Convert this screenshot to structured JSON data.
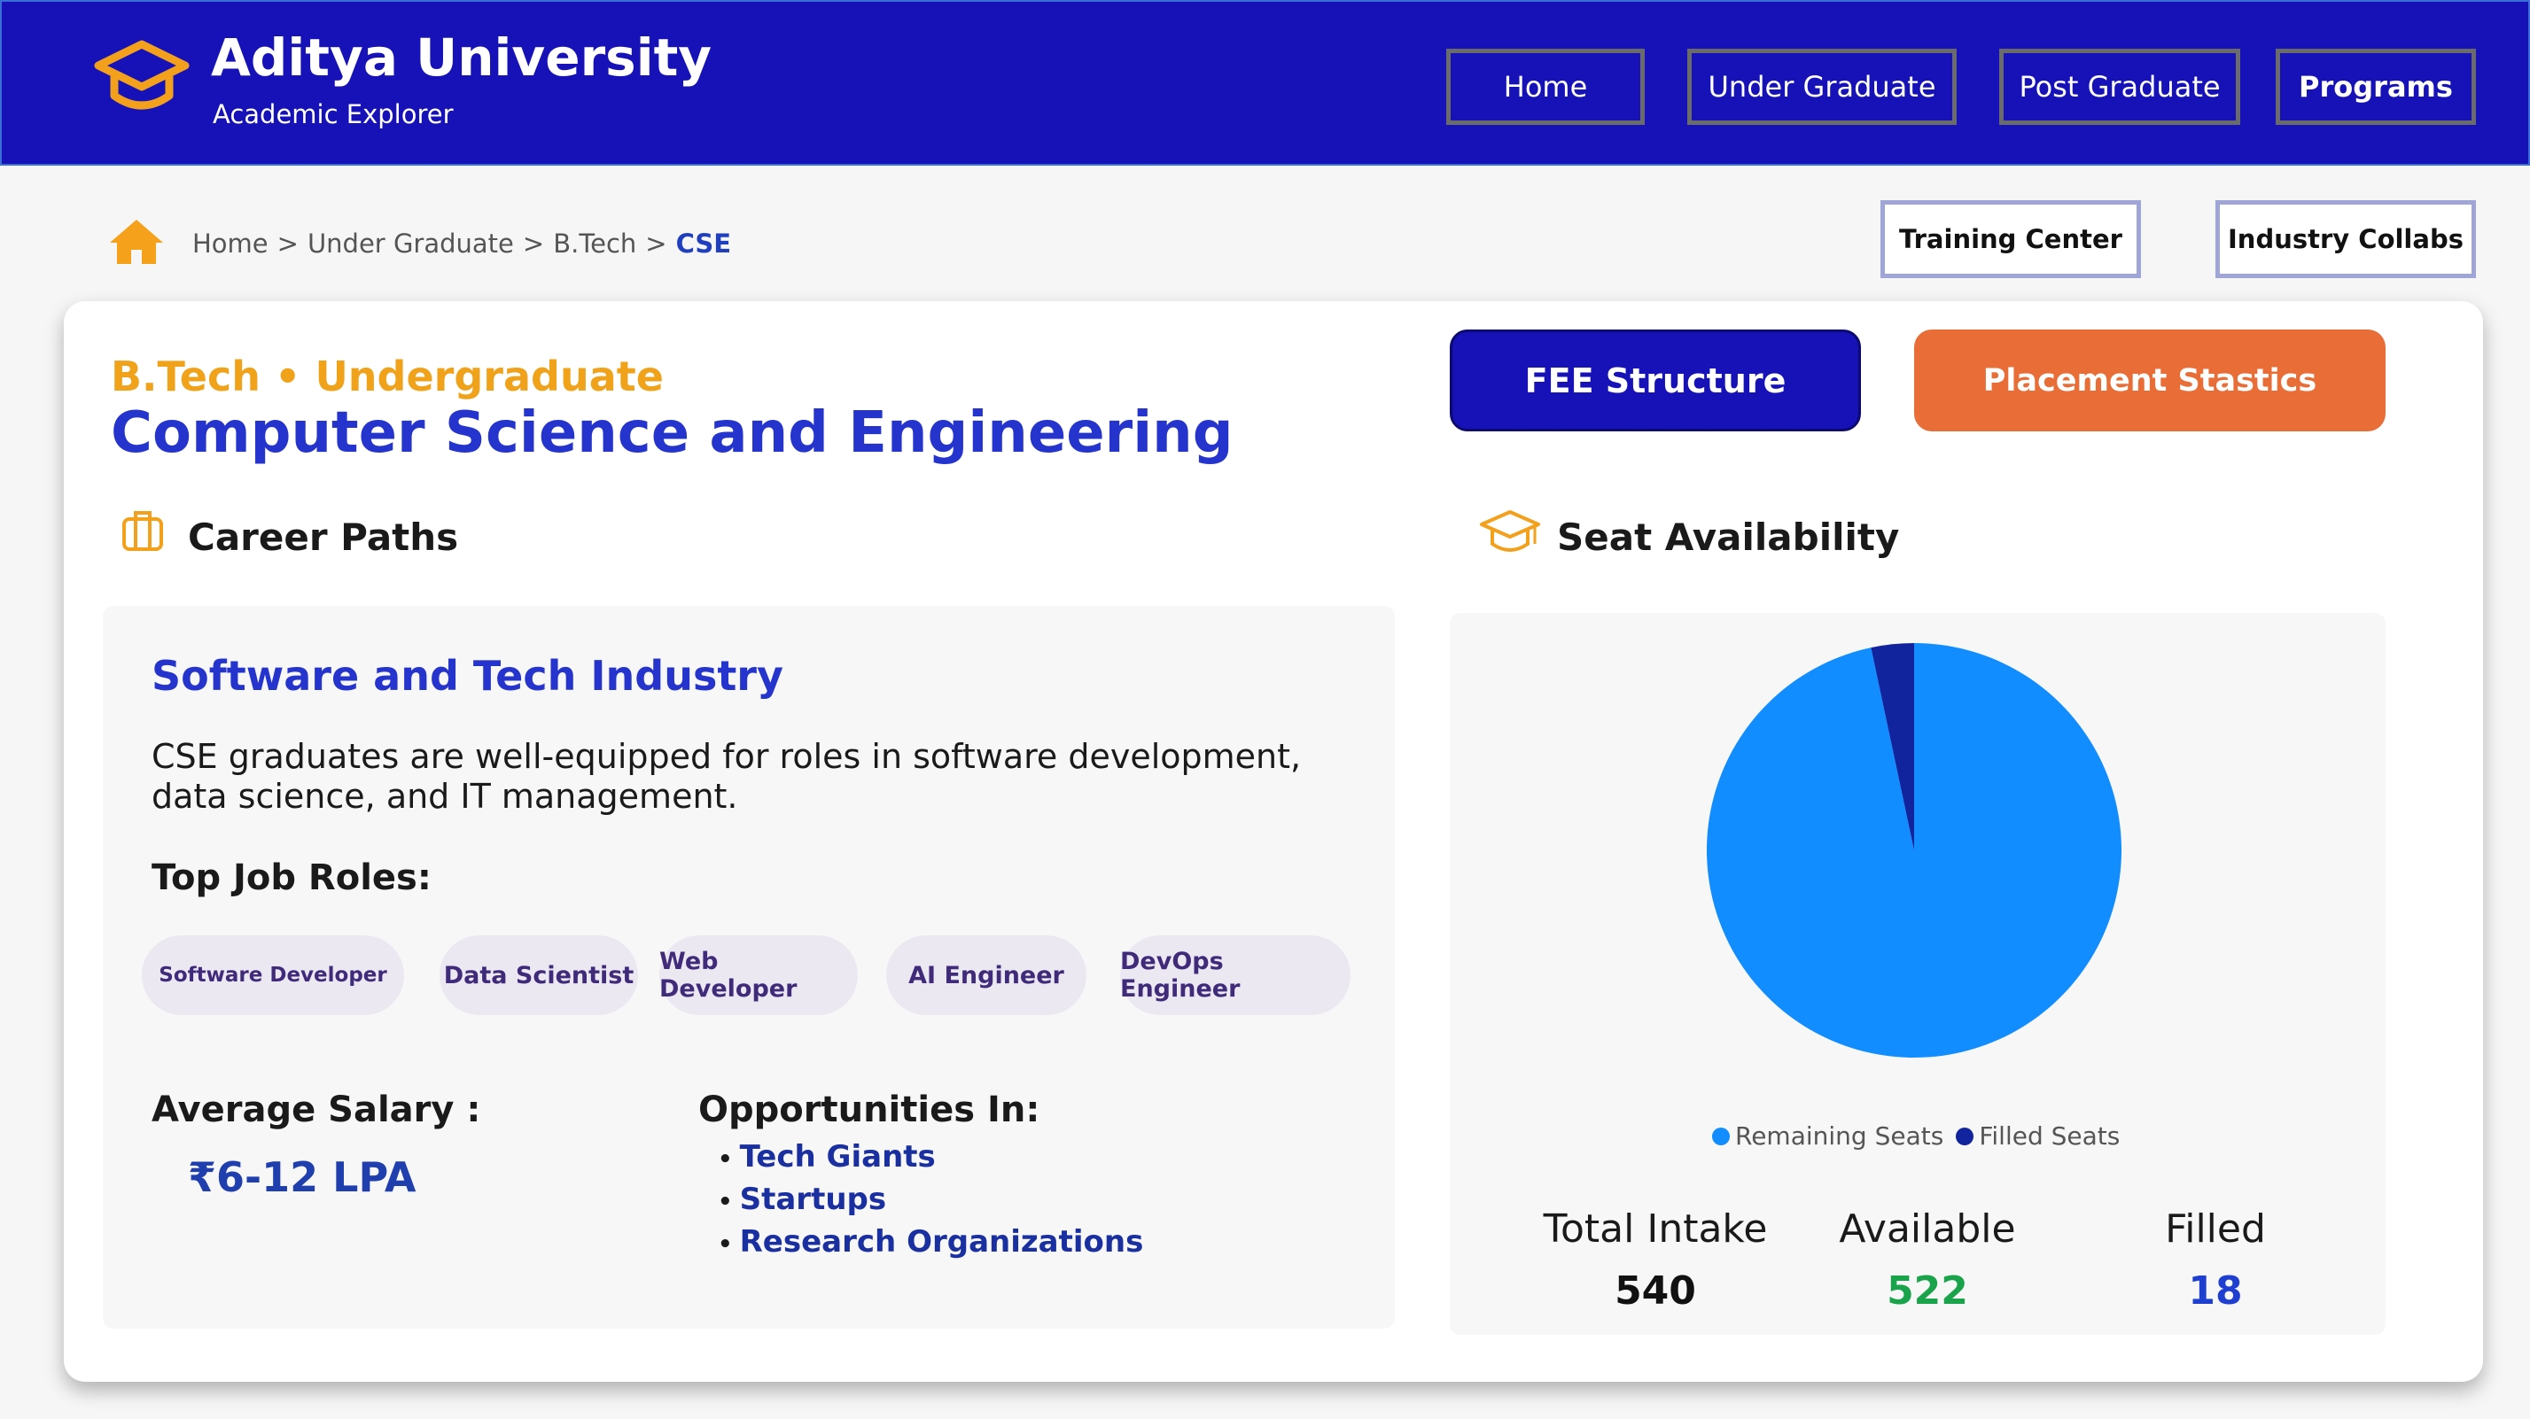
{
  "header": {
    "brand_title": "Aditya University",
    "brand_subtitle": "Academic Explorer",
    "nav": [
      {
        "label": "Home"
      },
      {
        "label": "Under Graduate"
      },
      {
        "label": "Post Graduate"
      },
      {
        "label": "Programs"
      }
    ]
  },
  "breadcrumb": {
    "items": [
      "Home",
      "Under Graduate",
      "B.Tech"
    ],
    "separator": ">",
    "current": "CSE"
  },
  "quick_links": {
    "training": "Training Center",
    "industry": "Industry Collabs"
  },
  "program": {
    "eyebrow": "B.Tech • Undergraduate",
    "title": "Computer Science and Engineering",
    "fee_button": "FEE Structure",
    "placement_button": "Placement Stastics"
  },
  "career": {
    "section_title": "Career Paths",
    "industry_title": "Software and Tech Industry",
    "description": "CSE graduates are well-equipped for roles in software development, data science, and IT management.",
    "roles_title": "Top Job Roles:",
    "roles": [
      "Software Developer",
      "Data Scientist",
      "Web Developer",
      "AI Engineer",
      "DevOps Engineer"
    ],
    "salary_label": "Average Salary :",
    "salary_value": "₹6-12 LPA",
    "opportunities_title": "Opportunities In:",
    "opportunities": [
      "Tech Giants",
      "Startups",
      "Research Organizations"
    ]
  },
  "seats": {
    "section_title": "Seat Availability",
    "legend": [
      "Remaining Seats",
      "Filled Seats"
    ],
    "stats": [
      {
        "label": "Total Intake",
        "value": "540"
      },
      {
        "label": "Available",
        "value": "522"
      },
      {
        "label": "Filled",
        "value": "18"
      }
    ]
  },
  "chart_data": {
    "type": "pie",
    "categories": [
      "Remaining Seats",
      "Filled Seats"
    ],
    "values": [
      522,
      18
    ],
    "colors": [
      "#118dff",
      "#12239e"
    ],
    "legend_position": "bottom"
  },
  "colors": {
    "header_bg": "#1612b8",
    "accent_orange": "#e86d36",
    "title_blue": "#2434cc",
    "eyebrow_gold": "#f0a21a",
    "available_green": "#1aa34a",
    "filled_blue": "#1f3fd0"
  }
}
